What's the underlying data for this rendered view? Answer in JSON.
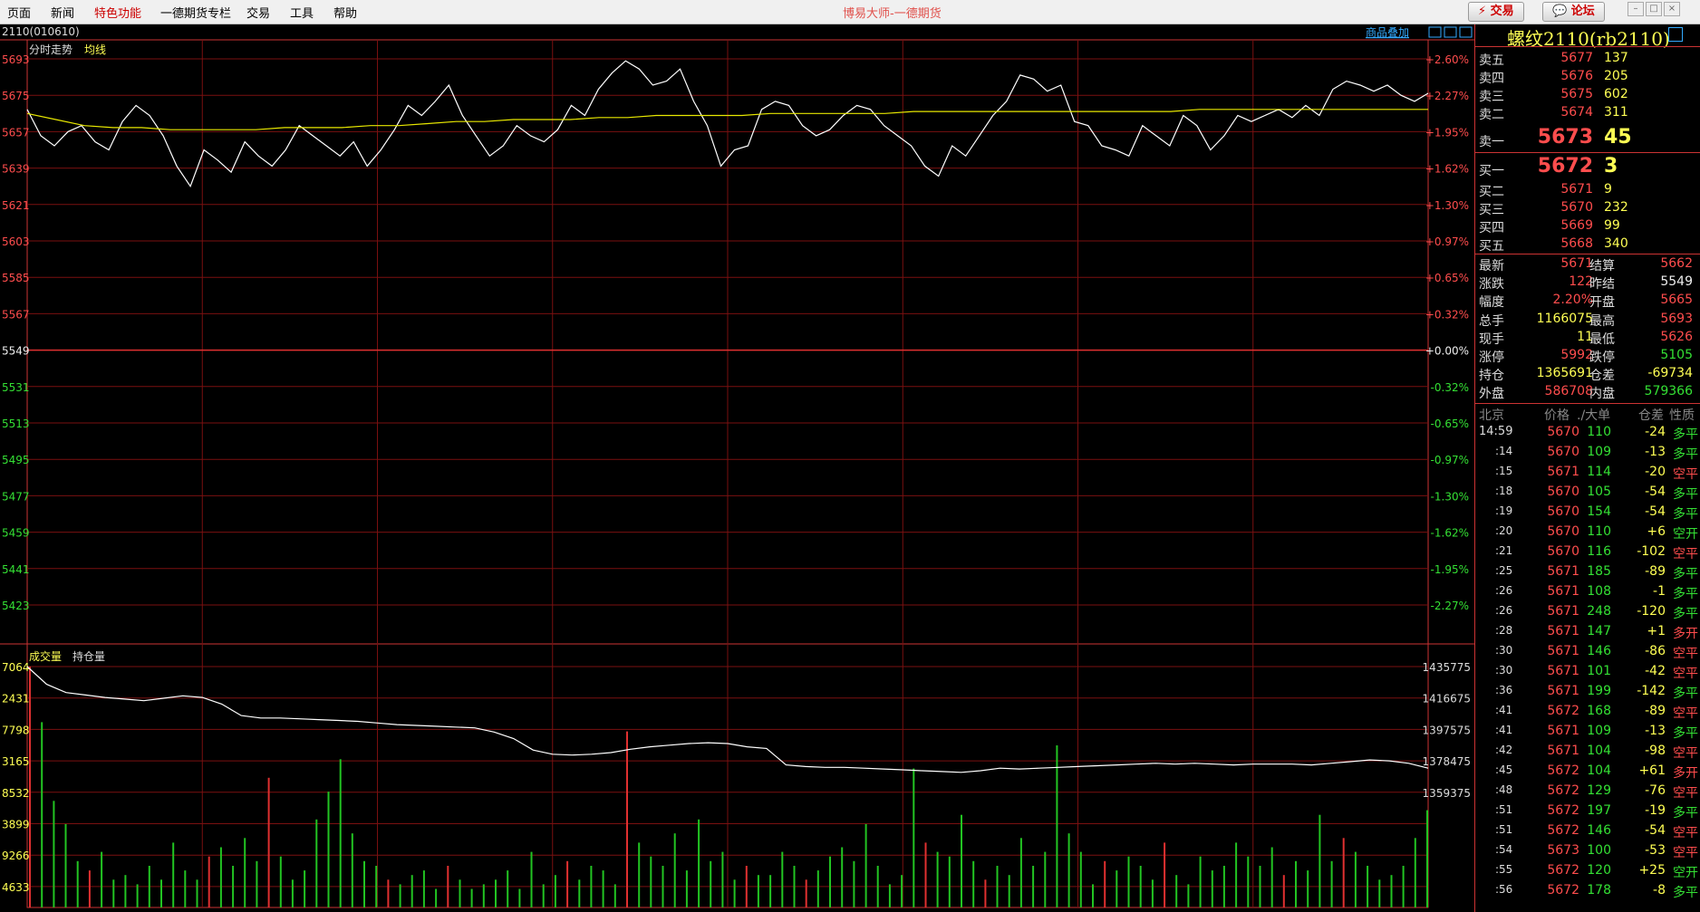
{
  "menu": [
    {
      "label": "页面",
      "hl": false
    },
    {
      "label": "新闻",
      "hl": false
    },
    {
      "label": "特色功能",
      "hl": true
    },
    {
      "label": "一德期货专栏",
      "hl": false
    },
    {
      "label": "交易",
      "hl": false
    },
    {
      "label": "工具",
      "hl": false
    },
    {
      "label": "帮助",
      "hl": false
    }
  ],
  "app_title": "博易大师-一德期货",
  "top_buttons": {
    "trade": "交易",
    "forum": "论坛"
  },
  "chart_header": {
    "code": "2110(010610)",
    "tab_intraday": "分时走势",
    "tab_avg": "均线",
    "overlay_link": "商品叠加",
    "vol_label": "成交量",
    "oi_label": "持仓量"
  },
  "chart_data": {
    "type": "line",
    "price_ticks": [
      5693,
      5675,
      5657,
      5639,
      5621,
      5603,
      5585,
      5567,
      5549,
      5531,
      5513,
      5495,
      5477,
      5459,
      5441,
      5423
    ],
    "pct_ticks": [
      "+2.60%",
      "+2.27%",
      "+1.95%",
      "+1.62%",
      "+1.30%",
      "+0.97%",
      "+0.65%",
      "+0.32%",
      "+0.00%",
      "-0.32%",
      "-0.65%",
      "-0.97%",
      "-1.30%",
      "-1.62%",
      "-1.95%",
      "-2.27%"
    ],
    "price_ylim": [
      5405,
      5693
    ],
    "vol_ticks_left": [
      "7064",
      "2431",
      "7798",
      "3165",
      "8532",
      "3899",
      "9266",
      "4633"
    ],
    "oi_ticks": [
      "1435775",
      "1416675",
      "1397575",
      "1378475",
      "1359375"
    ],
    "oi_ylim": [
      1359375,
      1435775
    ],
    "price_series": [
      5668,
      5655,
      5650,
      5657,
      5660,
      5652,
      5648,
      5662,
      5670,
      5665,
      5655,
      5640,
      5630,
      5648,
      5643,
      5637,
      5652,
      5645,
      5640,
      5648,
      5660,
      5655,
      5650,
      5645,
      5652,
      5640,
      5648,
      5658,
      5670,
      5665,
      5672,
      5680,
      5665,
      5655,
      5645,
      5650,
      5660,
      5655,
      5652,
      5658,
      5670,
      5665,
      5678,
      5686,
      5692,
      5688,
      5680,
      5682,
      5688,
      5672,
      5660,
      5640,
      5648,
      5650,
      5668,
      5672,
      5670,
      5660,
      5655,
      5658,
      5665,
      5670,
      5668,
      5660,
      5655,
      5650,
      5640,
      5635,
      5650,
      5645,
      5655,
      5665,
      5672,
      5685,
      5683,
      5677,
      5680,
      5662,
      5660,
      5650,
      5648,
      5645,
      5660,
      5655,
      5650,
      5665,
      5660,
      5648,
      5655,
      5665,
      5662,
      5665,
      5668,
      5664,
      5670,
      5665,
      5678,
      5682,
      5680,
      5677,
      5680,
      5675,
      5672,
      5676
    ],
    "avg_series": [
      5666,
      5663,
      5660,
      5659,
      5659,
      5658,
      5658,
      5658,
      5658,
      5659,
      5659,
      5659,
      5660,
      5660,
      5661,
      5662,
      5662,
      5663,
      5663,
      5663,
      5664,
      5664,
      5665,
      5665,
      5665,
      5665,
      5666,
      5666,
      5666,
      5666,
      5666,
      5667,
      5667,
      5667,
      5667,
      5667,
      5667,
      5667,
      5667,
      5667,
      5667,
      5668,
      5668,
      5668,
      5668,
      5668,
      5668,
      5668,
      5668,
      5668
    ],
    "oi_series": [
      1435775,
      1425000,
      1420000,
      1418500,
      1417000,
      1416000,
      1415000,
      1416500,
      1418000,
      1417000,
      1413000,
      1406000,
      1404500,
      1404500,
      1404000,
      1403500,
      1403000,
      1402500,
      1401500,
      1400500,
      1400000,
      1399500,
      1399000,
      1398500,
      1396000,
      1392000,
      1385000,
      1382500,
      1382000,
      1382500,
      1383500,
      1385500,
      1387000,
      1388000,
      1389000,
      1389500,
      1389000,
      1387000,
      1386000,
      1376000,
      1375000,
      1374500,
      1374500,
      1374000,
      1373500,
      1373000,
      1372500,
      1372000,
      1371500,
      1372500,
      1374000,
      1373500,
      1374000,
      1374500,
      1375000,
      1375500,
      1376000,
      1376500,
      1377000,
      1376500,
      1377000,
      1376500,
      1376000,
      1376500,
      1376500,
      1376500,
      1376000,
      1377000,
      1378000,
      1379000,
      1378500,
      1377000,
      1374000
    ],
    "volume_series": [
      52,
      40,
      23,
      18,
      10,
      8,
      12,
      6,
      7,
      5,
      9,
      6,
      14,
      8,
      6,
      11,
      13,
      9,
      15,
      10,
      28,
      11,
      6,
      8,
      19,
      25,
      32,
      16,
      10,
      9,
      6,
      5,
      7,
      8,
      4,
      9,
      6,
      4,
      5,
      6,
      8,
      4,
      12,
      5,
      7,
      10,
      6,
      9,
      8,
      5,
      38,
      14,
      11,
      9,
      16,
      8,
      19,
      10,
      12,
      6,
      9,
      7,
      7,
      12,
      9,
      6,
      8,
      11,
      13,
      10,
      18,
      9,
      5,
      7,
      30,
      14,
      12,
      11,
      20,
      10,
      6,
      9,
      7,
      15,
      9,
      12,
      35,
      16,
      12,
      5,
      10,
      8,
      11,
      9,
      6,
      14,
      7,
      5,
      11,
      8,
      9,
      14,
      11,
      9,
      13,
      7,
      10,
      8,
      20,
      10,
      15,
      12,
      9,
      6,
      7,
      9,
      15,
      21
    ]
  },
  "side": {
    "title": "螺纹2110(rb2110)",
    "asks": [
      {
        "label": "卖五",
        "price": "5677",
        "vol": "137"
      },
      {
        "label": "卖四",
        "price": "5676",
        "vol": "205"
      },
      {
        "label": "卖三",
        "price": "5675",
        "vol": "602"
      },
      {
        "label": "卖二",
        "price": "5674",
        "vol": "311"
      }
    ],
    "ask1": {
      "label": "卖一",
      "price": "5673",
      "vol": "45"
    },
    "bid1": {
      "label": "买一",
      "price": "5672",
      "vol": "3"
    },
    "bids": [
      {
        "label": "买二",
        "price": "5671",
        "vol": "9"
      },
      {
        "label": "买三",
        "price": "5670",
        "vol": "232"
      },
      {
        "label": "买四",
        "price": "5669",
        "vol": "99"
      },
      {
        "label": "买五",
        "price": "5668",
        "vol": "340"
      }
    ],
    "stats": [
      {
        "l1": "最新",
        "v1": "5671",
        "c1": "red",
        "l2": "结算",
        "v2": "5662",
        "c2": "red"
      },
      {
        "l1": "涨跌",
        "v1": "122",
        "c1": "red",
        "l2": "昨结",
        "v2": "5549",
        "c2": "white"
      },
      {
        "l1": "幅度",
        "v1": "2.20%",
        "c1": "red",
        "l2": "开盘",
        "v2": "5665",
        "c2": "red"
      },
      {
        "l1": "总手",
        "v1": "1166075",
        "c1": "yellow",
        "l2": "最高",
        "v2": "5693",
        "c2": "red"
      },
      {
        "l1": "现手",
        "v1": "11",
        "c1": "yellow",
        "l2": "最低",
        "v2": "5626",
        "c2": "red"
      },
      {
        "l1": "涨停",
        "v1": "5992",
        "c1": "red",
        "l2": "跌停",
        "v2": "5105",
        "c2": "green"
      },
      {
        "l1": "持仓",
        "v1": "1365691",
        "c1": "yellow",
        "l2": "仓差",
        "v2": "-69734",
        "c2": "yellow"
      },
      {
        "l1": "外盘",
        "v1": "586708",
        "c1": "red",
        "l2": "内盘",
        "v2": "579366",
        "c2": "green"
      }
    ],
    "tick_header": {
      "c0": "北京",
      "c1": "价格",
      "c2": "./大单",
      "c3": "仓差",
      "c4": "性质"
    },
    "ticks": [
      {
        "t": "14:59",
        "p": "5670",
        "v": "110",
        "d": "-24",
        "n": "多平",
        "nc": "green"
      },
      {
        "t": ":14",
        "p": "5670",
        "v": "109",
        "d": "-13",
        "n": "多平",
        "nc": "green"
      },
      {
        "t": ":15",
        "p": "5671",
        "v": "114",
        "d": "-20",
        "n": "空平",
        "nc": "red"
      },
      {
        "t": ":18",
        "p": "5670",
        "v": "105",
        "d": "-54",
        "n": "多平",
        "nc": "green"
      },
      {
        "t": ":19",
        "p": "5670",
        "v": "154",
        "d": "-54",
        "n": "多平",
        "nc": "green"
      },
      {
        "t": ":20",
        "p": "5670",
        "v": "110",
        "d": "+6",
        "n": "空开",
        "nc": "green"
      },
      {
        "t": ":21",
        "p": "5670",
        "v": "116",
        "d": "-102",
        "n": "空平",
        "nc": "red"
      },
      {
        "t": ":25",
        "p": "5671",
        "v": "185",
        "d": "-89",
        "n": "多平",
        "nc": "green"
      },
      {
        "t": ":26",
        "p": "5671",
        "v": "108",
        "d": "-1",
        "n": "多平",
        "nc": "green"
      },
      {
        "t": ":26",
        "p": "5671",
        "v": "248",
        "d": "-120",
        "n": "多平",
        "nc": "green"
      },
      {
        "t": ":28",
        "p": "5671",
        "v": "147",
        "d": "+1",
        "n": "多开",
        "nc": "red"
      },
      {
        "t": ":30",
        "p": "5671",
        "v": "146",
        "d": "-86",
        "n": "空平",
        "nc": "red"
      },
      {
        "t": ":30",
        "p": "5671",
        "v": "101",
        "d": "-42",
        "n": "空平",
        "nc": "red"
      },
      {
        "t": ":36",
        "p": "5671",
        "v": "199",
        "d": "-142",
        "n": "多平",
        "nc": "green"
      },
      {
        "t": ":41",
        "p": "5672",
        "v": "168",
        "d": "-89",
        "n": "空平",
        "nc": "red"
      },
      {
        "t": ":41",
        "p": "5671",
        "v": "109",
        "d": "-13",
        "n": "多平",
        "nc": "green"
      },
      {
        "t": ":42",
        "p": "5671",
        "v": "104",
        "d": "-98",
        "n": "空平",
        "nc": "red"
      },
      {
        "t": ":45",
        "p": "5672",
        "v": "104",
        "d": "+61",
        "n": "多开",
        "nc": "red"
      },
      {
        "t": ":48",
        "p": "5672",
        "v": "129",
        "d": "-76",
        "n": "空平",
        "nc": "red"
      },
      {
        "t": ":51",
        "p": "5672",
        "v": "197",
        "d": "-19",
        "n": "多平",
        "nc": "green"
      },
      {
        "t": ":51",
        "p": "5672",
        "v": "146",
        "d": "-54",
        "n": "空平",
        "nc": "red"
      },
      {
        "t": ":54",
        "p": "5673",
        "v": "100",
        "d": "-53",
        "n": "空平",
        "nc": "red"
      },
      {
        "t": ":55",
        "p": "5672",
        "v": "120",
        "d": "+25",
        "n": "空开",
        "nc": "green"
      },
      {
        "t": ":56",
        "p": "5672",
        "v": "178",
        "d": "-8",
        "n": "多平",
        "nc": "green"
      }
    ]
  }
}
